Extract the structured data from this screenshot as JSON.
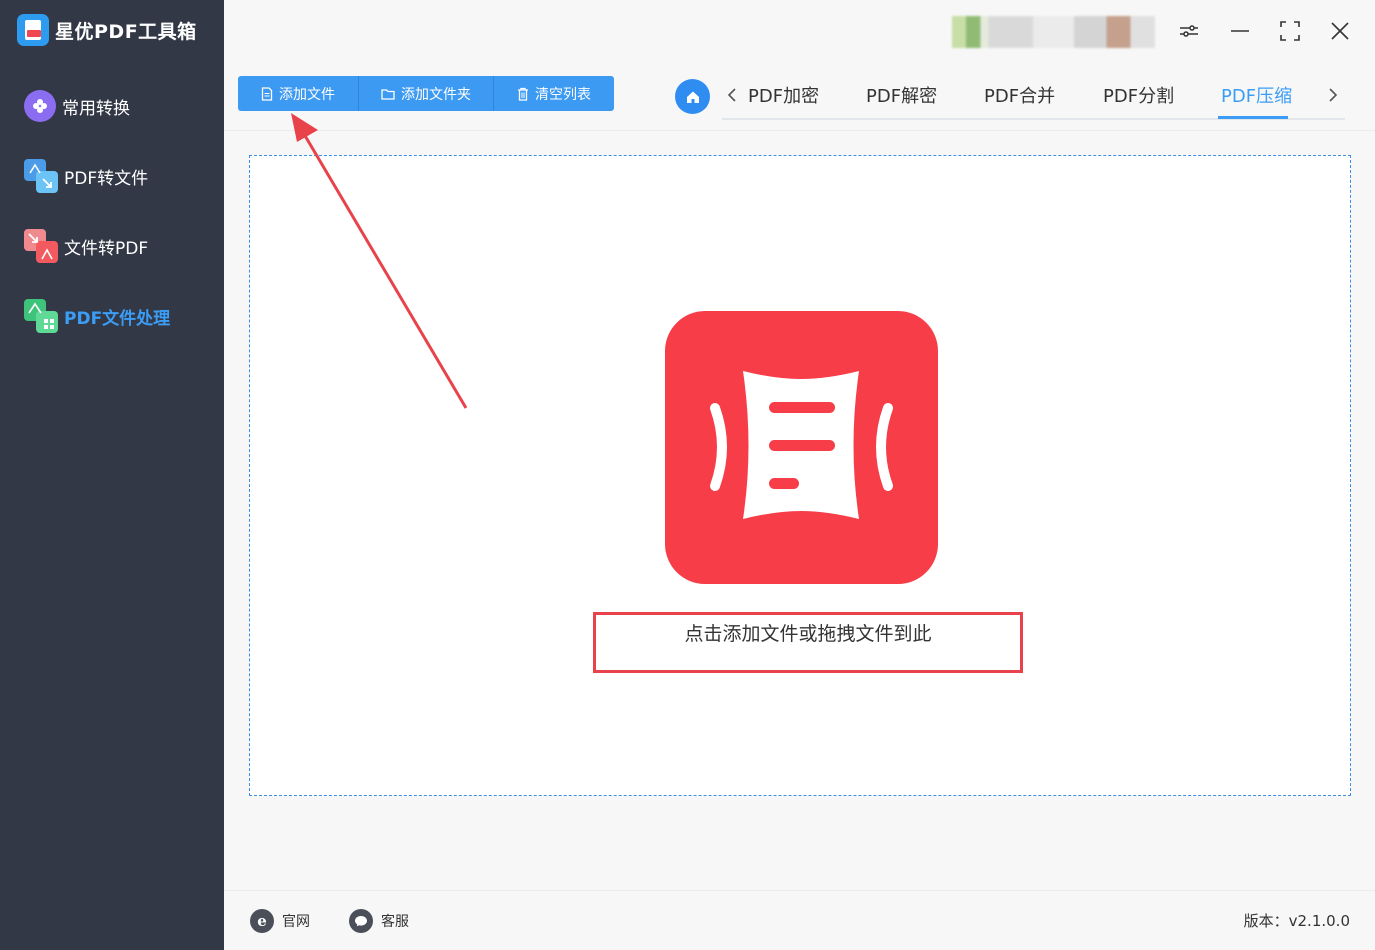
{
  "app": {
    "title": "星优PDF工具箱",
    "logo_icon": "pdf-logo-icon"
  },
  "sidebar": {
    "items": [
      {
        "label": "常用转换",
        "icon": "flower-icon",
        "active": false
      },
      {
        "label": "PDF转文件",
        "icon": "pdf-to-file-icon",
        "active": false
      },
      {
        "label": "文件转PDF",
        "icon": "file-to-pdf-icon",
        "active": false
      },
      {
        "label": "PDF文件处理",
        "icon": "pdf-process-icon",
        "active": true
      }
    ]
  },
  "toolbar": {
    "add_file": "添加文件",
    "add_folder": "添加文件夹",
    "clear_list": "清空列表"
  },
  "tabs": {
    "items": [
      "PDF加密",
      "PDF解密",
      "PDF合并",
      "PDF分割",
      "PDF压缩"
    ],
    "active": "PDF压缩"
  },
  "dropzone": {
    "hint": "点击添加文件或拖拽文件到此",
    "icon": "pdf-compress-icon"
  },
  "footer": {
    "website": "官网",
    "support": "客服",
    "version": "版本：v2.1.0.0"
  },
  "colors": {
    "sidebar_bg": "#323845",
    "accent": "#3b9df5",
    "toolbar_btn": "#3d9af2",
    "icon_red": "#f73d47",
    "annotation_red": "#e8434b"
  }
}
